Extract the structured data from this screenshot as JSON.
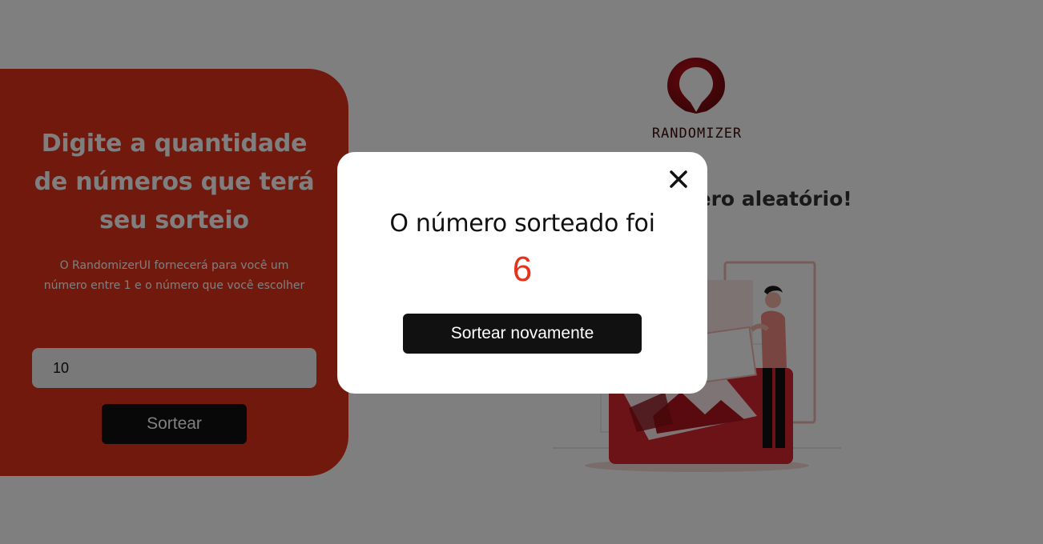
{
  "left_card": {
    "title": "Digite a quantidade de números que terá seu sorteio",
    "description": "O RandomizerUI fornecerá para você um número entre 1 e o número que você escolher",
    "input_value": "10",
    "button_label": "Sortear"
  },
  "brand": {
    "logo_icon": "map-pin-logo-icon",
    "name": "RANDOMIZER"
  },
  "right": {
    "heading": "Sorteie seu número aleatório!",
    "illustration": "person-with-picture-frames-illustration"
  },
  "modal": {
    "title": "O número sorteado foi",
    "number": "6",
    "button_label": "Sortear novamente",
    "close_icon": "close-icon"
  },
  "colors": {
    "accent": "#e5331b",
    "dark": "#111111",
    "overlay": "rgba(0,0,0,0.5)"
  }
}
